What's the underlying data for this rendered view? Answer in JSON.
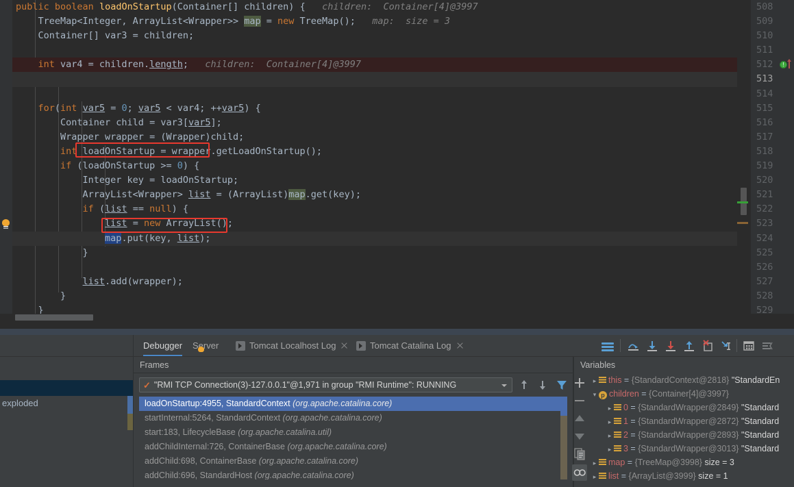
{
  "editor": {
    "lines": [
      {
        "n": "508",
        "state": "normal",
        "indent": 0,
        "tokens": [
          {
            "t": "public ",
            "c": "kw"
          },
          {
            "t": "boolean ",
            "c": "kw"
          },
          {
            "t": "loadOnStartup",
            "c": "mname"
          },
          {
            "t": "(",
            "c": "punct"
          },
          {
            "t": "Container",
            "c": "type"
          },
          {
            "t": "[] children) {",
            "c": "punct"
          },
          {
            "t": "   children:  Container[4]@3997",
            "c": "hint"
          }
        ]
      },
      {
        "n": "509",
        "state": "normal",
        "indent": 1,
        "tokens": [
          {
            "t": "    TreeMap<Integer, ArrayList<Wrapper>> ",
            "c": "type"
          },
          {
            "t": "map",
            "c": "mapsel"
          },
          {
            "t": " = ",
            "c": "punct"
          },
          {
            "t": "new ",
            "c": "kw"
          },
          {
            "t": "TreeMap();",
            "c": "type"
          },
          {
            "t": "   map:  size = 3",
            "c": "hint"
          }
        ]
      },
      {
        "n": "510",
        "state": "normal",
        "indent": 1,
        "tokens": [
          {
            "t": "    Container[] var3 = children;",
            "c": "type"
          }
        ]
      },
      {
        "n": "511",
        "state": "normal",
        "indent": 1,
        "tokens": []
      },
      {
        "n": "512",
        "state": "exec",
        "indent": 1,
        "bp": true,
        "tokens": [
          {
            "t": "    ",
            "c": "punct"
          },
          {
            "t": "int ",
            "c": "kw"
          },
          {
            "t": "var4 = children.",
            "c": "type"
          },
          {
            "t": "length",
            "c": "fieldu"
          },
          {
            "t": ";",
            "c": "punct"
          },
          {
            "t": "   children:  Container[4]@3997",
            "c": "hint"
          }
        ]
      },
      {
        "n": "513",
        "state": "current",
        "indent": 1,
        "tokens": []
      },
      {
        "n": "514",
        "state": "normal",
        "indent": 1,
        "tokens": []
      },
      {
        "n": "515",
        "state": "normal",
        "indent": 1,
        "tokens": [
          {
            "t": "    ",
            "c": "punct"
          },
          {
            "t": "for",
            "c": "kw"
          },
          {
            "t": "(",
            "c": "punct"
          },
          {
            "t": "int ",
            "c": "kw"
          },
          {
            "t": "var5",
            "c": "fieldu"
          },
          {
            "t": " = ",
            "c": "punct"
          },
          {
            "t": "0",
            "c": "num"
          },
          {
            "t": "; ",
            "c": "punct"
          },
          {
            "t": "var5",
            "c": "fieldu"
          },
          {
            "t": " < var4; ++",
            "c": "punct"
          },
          {
            "t": "var5",
            "c": "fieldu"
          },
          {
            "t": ") {",
            "c": "punct"
          }
        ]
      },
      {
        "n": "516",
        "state": "normal",
        "indent": 2,
        "tokens": [
          {
            "t": "        Container child = var3[",
            "c": "type"
          },
          {
            "t": "var5",
            "c": "fieldu"
          },
          {
            "t": "];",
            "c": "punct"
          }
        ]
      },
      {
        "n": "517",
        "state": "normal",
        "indent": 2,
        "tokens": [
          {
            "t": "        Wrapper wrapper = (Wrapper)child;",
            "c": "type"
          }
        ]
      },
      {
        "n": "518",
        "state": "normal",
        "indent": 2,
        "tokens": [
          {
            "t": "        ",
            "c": "punct"
          },
          {
            "t": "int ",
            "c": "kw"
          },
          {
            "t": "loadOnStartup = wrapper.getLoadOnStartup();",
            "c": "type"
          }
        ]
      },
      {
        "n": "519",
        "state": "normal",
        "indent": 2,
        "tokens": [
          {
            "t": "        ",
            "c": "punct"
          },
          {
            "t": "if ",
            "c": "kw"
          },
          {
            "t": "(loadOnStartup >= ",
            "c": "punct"
          },
          {
            "t": "0",
            "c": "num"
          },
          {
            "t": ") {",
            "c": "punct"
          }
        ]
      },
      {
        "n": "520",
        "state": "normal",
        "indent": 3,
        "tokens": [
          {
            "t": "            Integer key = loadOnStartup;",
            "c": "type"
          }
        ]
      },
      {
        "n": "521",
        "state": "normal",
        "indent": 3,
        "tokens": [
          {
            "t": "            ArrayList<Wrapper> ",
            "c": "type"
          },
          {
            "t": "list",
            "c": "fieldu"
          },
          {
            "t": " = (ArrayList)",
            "c": "punct"
          },
          {
            "t": "map",
            "c": "mapsel"
          },
          {
            "t": ".get(key);",
            "c": "punct"
          }
        ]
      },
      {
        "n": "522",
        "state": "normal",
        "indent": 3,
        "tokens": [
          {
            "t": "            ",
            "c": "punct"
          },
          {
            "t": "if ",
            "c": "kw"
          },
          {
            "t": "(",
            "c": "punct"
          },
          {
            "t": "list",
            "c": "fieldu"
          },
          {
            "t": " == ",
            "c": "punct"
          },
          {
            "t": "null",
            "c": "kw"
          },
          {
            "t": ") {",
            "c": "punct"
          }
        ]
      },
      {
        "n": "523",
        "state": "normal",
        "indent": 4,
        "tokens": [
          {
            "t": "                ",
            "c": "punct"
          },
          {
            "t": "list",
            "c": "fieldu"
          },
          {
            "t": " = ",
            "c": "punct"
          },
          {
            "t": "new ",
            "c": "kw"
          },
          {
            "t": "ArrayList();",
            "c": "type"
          }
        ]
      },
      {
        "n": "524",
        "state": "current2",
        "indent": 4,
        "bulb": true,
        "tokens": [
          {
            "t": "                ",
            "c": "punct"
          },
          {
            "t": "map",
            "c": "mapblue"
          },
          {
            "t": ".put(key, ",
            "c": "punct"
          },
          {
            "t": "list",
            "c": "fieldu"
          },
          {
            "t": ");",
            "c": "punct"
          }
        ]
      },
      {
        "n": "525",
        "state": "normal",
        "indent": 3,
        "tokens": [
          {
            "t": "            }",
            "c": "punct"
          }
        ]
      },
      {
        "n": "526",
        "state": "normal",
        "indent": 3,
        "tokens": []
      },
      {
        "n": "527",
        "state": "normal",
        "indent": 3,
        "tokens": [
          {
            "t": "            ",
            "c": "punct"
          },
          {
            "t": "list",
            "c": "fieldu"
          },
          {
            "t": ".add(wrapper);",
            "c": "punct"
          }
        ]
      },
      {
        "n": "528",
        "state": "normal",
        "indent": 2,
        "tokens": [
          {
            "t": "        }",
            "c": "punct"
          }
        ]
      },
      {
        "n": "529",
        "state": "normal",
        "indent": 1,
        "tokens": [
          {
            "t": "    }",
            "c": "punct"
          }
        ]
      }
    ],
    "line_numbers": [
      "508",
      "509",
      "510",
      "511",
      "512",
      "513",
      "514",
      "515",
      "516",
      "517",
      "518",
      "519",
      "520",
      "521",
      "522",
      "523",
      "524",
      "525",
      "526",
      "527",
      "528",
      "529"
    ],
    "current_line_number": "513",
    "breakpoint_line_number": "512",
    "annotations": [
      {
        "label": "if-condition-highlight",
        "color": "#e8392e"
      },
      {
        "label": "map-put-highlight",
        "color": "#e8392e"
      }
    ]
  },
  "left_panel": {
    "artifact_label": "exploded"
  },
  "tabs": [
    {
      "label": "Debugger",
      "active": true,
      "icon": "none",
      "closable": false
    },
    {
      "label": "Server",
      "active": false,
      "icon": "none",
      "closable": false
    },
    {
      "label": "Tomcat Localhost Log",
      "active": false,
      "icon": "play-icon",
      "closable": true
    },
    {
      "label": "Tomcat Catalina Log",
      "active": false,
      "icon": "play-icon",
      "closable": true
    }
  ],
  "debugger_toolbar": [
    {
      "name": "show-execution-point-icon",
      "title": "Show Execution Point"
    },
    {
      "name": "step-over-icon",
      "title": "Step Over"
    },
    {
      "name": "step-into-icon",
      "title": "Step Into"
    },
    {
      "name": "force-step-into-icon",
      "title": "Force Step Into"
    },
    {
      "name": "step-out-icon",
      "title": "Step Out"
    },
    {
      "name": "drop-frame-icon",
      "title": "Drop Frame"
    },
    {
      "name": "run-to-cursor-icon",
      "title": "Run to Cursor"
    },
    {
      "name": "evaluate-expression-icon",
      "title": "Evaluate Expression"
    },
    {
      "name": "settings-layout-icon",
      "title": "Layout Settings"
    }
  ],
  "frames": {
    "header": "Frames",
    "thread": {
      "text": "\"RMI TCP Connection(3)-127.0.0.1\"@1,971 in group \"RMI Runtime\": RUNNING",
      "status_icon": "check-icon"
    },
    "rows": [
      {
        "method": "loadOnStartup:4955, StandardContext ",
        "pkg": "(org.apache.catalina.core)",
        "selected": true
      },
      {
        "method": "startInternal:5264, StandardContext ",
        "pkg": "(org.apache.catalina.core)",
        "selected": false
      },
      {
        "method": "start:183, LifecycleBase ",
        "pkg": "(org.apache.catalina.util)",
        "selected": false
      },
      {
        "method": "addChildInternal:726, ContainerBase ",
        "pkg": "(org.apache.catalina.core)",
        "selected": false
      },
      {
        "method": "addChild:698, ContainerBase ",
        "pkg": "(org.apache.catalina.core)",
        "selected": false
      },
      {
        "method": "addChild:696, StandardHost ",
        "pkg": "(org.apache.catalina.core)",
        "selected": false
      }
    ]
  },
  "variables": {
    "header": "Variables",
    "rows": [
      {
        "indent": 0,
        "twisty": "right",
        "icon": "object-icon",
        "name": "this",
        "ref": "{StandardContext@2818}",
        "value": "\"StandardEn"
      },
      {
        "indent": 0,
        "twisty": "down",
        "icon": "field-icon",
        "name": "children",
        "ref": "{Container[4]@3997}",
        "value": ""
      },
      {
        "indent": 1,
        "twisty": "right",
        "icon": "object-icon",
        "name": "0",
        "ref": "{StandardWrapper@2849}",
        "value": "\"Standard"
      },
      {
        "indent": 1,
        "twisty": "right",
        "icon": "object-icon",
        "name": "1",
        "ref": "{StandardWrapper@2872}",
        "value": "\"Standard"
      },
      {
        "indent": 1,
        "twisty": "right",
        "icon": "object-icon",
        "name": "2",
        "ref": "{StandardWrapper@2893}",
        "value": "\"Standard"
      },
      {
        "indent": 1,
        "twisty": "right",
        "icon": "object-icon",
        "name": "3",
        "ref": "{StandardWrapper@3013}",
        "value": "\"Standard"
      },
      {
        "indent": 0,
        "twisty": "right",
        "icon": "object-icon",
        "name": "map",
        "ref": "{TreeMap@3998}",
        "value": "size = 3"
      },
      {
        "indent": 0,
        "twisty": "right",
        "icon": "object-icon",
        "name": "list",
        "ref": "{ArrayList@3999}",
        "value": "size = 1"
      }
    ]
  },
  "side_toolbar": [
    {
      "name": "add-watch-button",
      "glyph": "+"
    },
    {
      "name": "remove-watch-button",
      "glyph": "−"
    },
    {
      "name": "move-up-button",
      "glyph": "▲"
    },
    {
      "name": "move-down-button",
      "glyph": "▼"
    },
    {
      "name": "copy-value-button",
      "glyph": "copy"
    },
    {
      "name": "watches-button",
      "glyph": "oo",
      "active": true
    }
  ],
  "colors": {
    "editor_bg": "#2b2b2b",
    "panel_bg": "#3c3f41",
    "accent_blue": "#4a88c7",
    "selection_blue": "#4b6eaf",
    "annotation_red": "#e8392e",
    "keyword_orange": "#cc7832",
    "method_yellow": "#ffc66d",
    "number_blue": "#6897bb",
    "comment_gray": "#808080"
  }
}
